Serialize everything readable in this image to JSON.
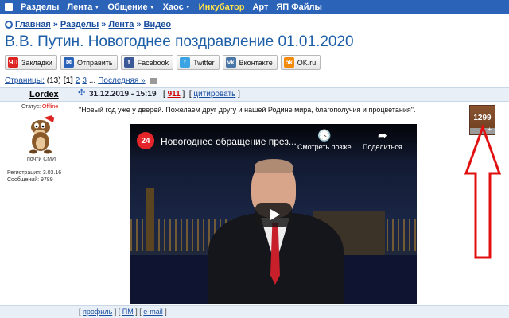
{
  "topnav": {
    "items": [
      {
        "label": "Разделы",
        "dropdown": false
      },
      {
        "label": "Лента",
        "dropdown": true
      },
      {
        "label": "Общение",
        "dropdown": true
      },
      {
        "label": "Хаос",
        "dropdown": true
      },
      {
        "label": "Инкубатор",
        "dropdown": false
      },
      {
        "label": "Арт",
        "dropdown": false
      },
      {
        "label": "ЯП Файлы",
        "dropdown": false
      }
    ],
    "accent_color": "#ffe24a",
    "bar_color": "#2b63b8"
  },
  "breadcrumb": {
    "items": [
      "Главная",
      "Разделы",
      "Лента",
      "Видео"
    ],
    "separator": "»"
  },
  "page_title": "В.В. Путин. Новогоднее поздравление 01.01.2020",
  "share": {
    "buttons": [
      {
        "label": "Закладки",
        "icon": "yap-bookmark-icon",
        "color": "#d22"
      },
      {
        "label": "Отправить",
        "icon": "mail-icon",
        "color": "#2b63b8"
      },
      {
        "label": "Facebook",
        "icon": "facebook-icon",
        "color": "#3b5998"
      },
      {
        "label": "Twitter",
        "icon": "twitter-icon",
        "color": "#3aa3e3"
      },
      {
        "label": "Вконтакте",
        "icon": "vk-icon",
        "color": "#4a76a8"
      },
      {
        "label": "OK.ru",
        "icon": "ok-icon",
        "color": "#f2890a"
      }
    ]
  },
  "pagination": {
    "prefix": "Страницы:",
    "count": "(13)",
    "current": "[1]",
    "pages": [
      "2",
      "3"
    ],
    "ellipsis": "...",
    "last": "Последняя »"
  },
  "post": {
    "author": "Lordex",
    "date": "31.12.2019 - 15:19",
    "number": "911",
    "quote_label": "цитировать",
    "status_label": "Статус:",
    "status_value": "Offline",
    "avatar_caption": "почти СМИ",
    "registration_label": "Регистрация:",
    "registration_value": "3.03.16",
    "messages_label": "Сообщений:",
    "messages_value": "9789",
    "text": "\"Новый год уже у дверей. Пожелаем друг другу и нашей Родине мира, благополучия и процветания\".",
    "rating": "1299"
  },
  "video": {
    "channel_logo": "24",
    "title": "Новогоднее обращение през...",
    "watch_later_label": "Смотреть позже",
    "share_label": "Поделиться"
  },
  "footer": {
    "links": [
      "профиль",
      "ПМ",
      "e-mail"
    ]
  }
}
